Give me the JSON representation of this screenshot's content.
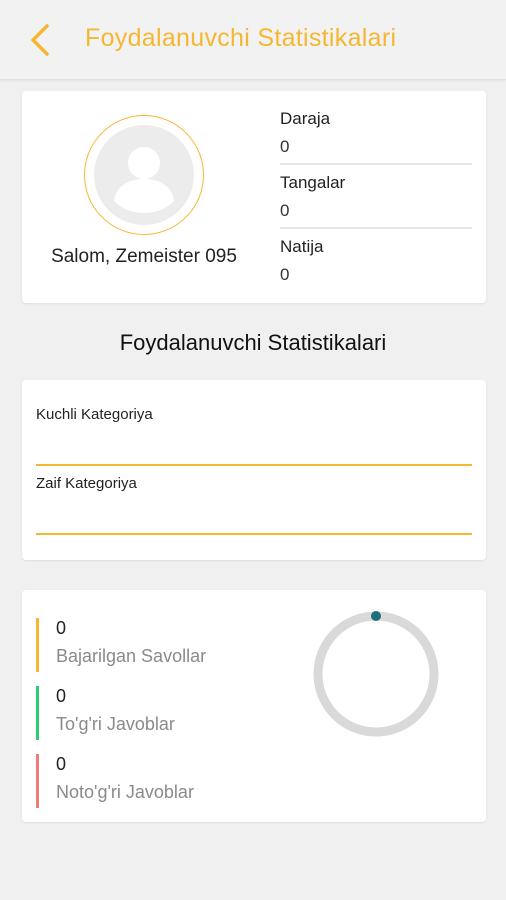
{
  "appbar": {
    "title": "Foydalanuvchi Statistikalari",
    "back_icon": "chevron-left-icon",
    "accent_color": "#f5b731"
  },
  "profile": {
    "avatar_icon": "user-avatar-icon",
    "greeting": "Salom, Zemeister 095",
    "stats": [
      {
        "label": "Daraja",
        "value": "0"
      },
      {
        "label": "Tangalar",
        "value": "0"
      },
      {
        "label": "Natija",
        "value": "0"
      }
    ]
  },
  "section_title": "Foydalanuvchi Statistikalari",
  "categories": {
    "strong_label": "Kuchli Kategoriya",
    "weak_label": "Zaif Kategoriya"
  },
  "questions": {
    "items": [
      {
        "value": "0",
        "label": "Bajarilgan Savollar",
        "color": "#f5b731"
      },
      {
        "value": "0",
        "label": "To'g'ri Javoblar",
        "color": "#2ecc71"
      },
      {
        "value": "0",
        "label": "Noto'g'ri Javoblar",
        "color": "#ef7b7b"
      }
    ],
    "progress_fraction": 0,
    "ring_color": "#d9d9d9",
    "indicator_color": "#1d6e7e"
  }
}
